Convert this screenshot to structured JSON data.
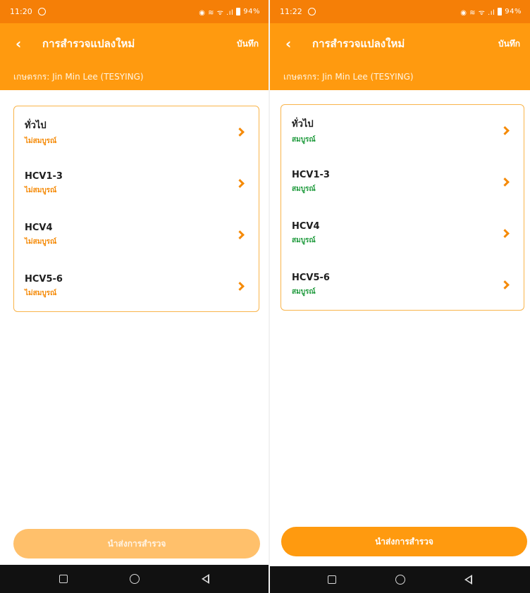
{
  "left": {
    "status": {
      "time": "11:20",
      "indicators": "◉ ≋ ᯤ .ıl",
      "battery": "94%"
    },
    "app_bar": {
      "back_icon": "chevron-left-icon",
      "title": "การสำรวจแปลงใหม่",
      "save_label": "บันทึก"
    },
    "farmer_label": "เกษตรกร: Jin Min Lee (TESYING)",
    "sections": [
      {
        "title": "ทั่วไป",
        "status": "ไม่สมบูรณ์"
      },
      {
        "title": "HCV1-3",
        "status": "ไม่สมบูรณ์"
      },
      {
        "title": "HCV4",
        "status": "ไม่สมบูรณ์"
      },
      {
        "title": "HCV5-6",
        "status": "ไม่สมบูรณ์"
      }
    ],
    "submit_label": "นำส่งการสำรวจ"
  },
  "right": {
    "status": {
      "time": "11:22",
      "indicators": "◉ ≋ ᯤ .ıl",
      "battery": "94%"
    },
    "app_bar": {
      "back_icon": "chevron-left-icon",
      "title": "การสำรวจแปลงใหม่",
      "save_label": "บันทึก"
    },
    "farmer_label": "เกษตรกร: Jin Min Lee (TESYING)",
    "sections": [
      {
        "title": "ทั่วไป",
        "status": "สมบูรณ์"
      },
      {
        "title": "HCV1-3",
        "status": "สมบูรณ์"
      },
      {
        "title": "HCV4",
        "status": "สมบูรณ์"
      },
      {
        "title": "HCV5-6",
        "status": "สมบูรณ์"
      }
    ],
    "submit_label": "นำส่งการสำรวจ"
  },
  "colors": {
    "status_bar": "#f57f07",
    "app_bar": "#ff9a0f",
    "incomplete": "#f58a07",
    "complete": "#1e9a3c",
    "submit_disabled": "#ffc06b",
    "submit_enabled": "#ff9a0f"
  }
}
